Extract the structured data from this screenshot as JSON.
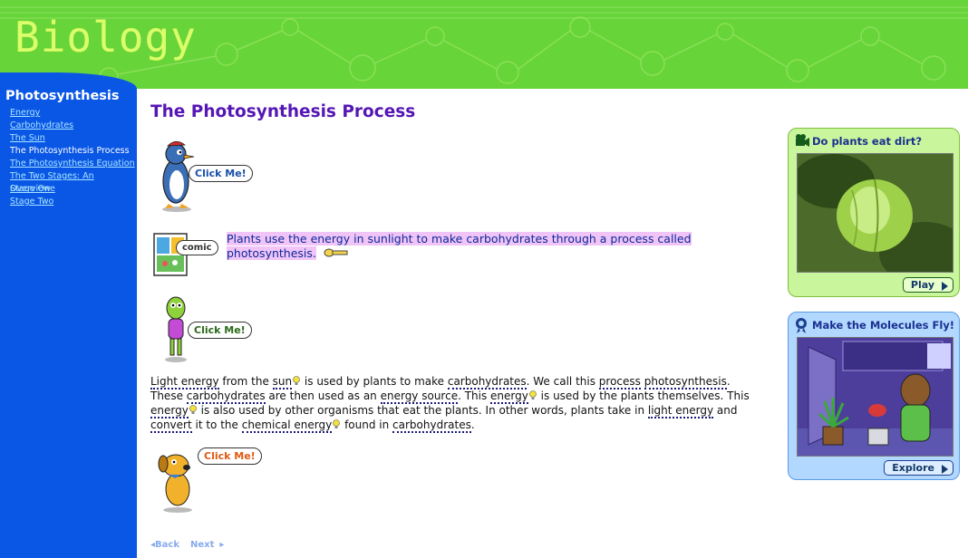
{
  "header": {
    "title": "Biology"
  },
  "sidebar": {
    "section_title": "Photosynthesis",
    "items": [
      {
        "label": "Energy",
        "current": false
      },
      {
        "label": "Carbohydrates",
        "current": false
      },
      {
        "label": "The Sun",
        "current": false
      },
      {
        "label": "The Photosynthesis Process",
        "current": true
      },
      {
        "label": "The Photosynthesis Equation",
        "current": false
      },
      {
        "label": "The Two Stages: An Overview",
        "current": false
      },
      {
        "label": "Stage One",
        "current": false
      },
      {
        "label": "Stage Two",
        "current": false
      }
    ]
  },
  "main": {
    "title": "The Photosynthesis Process",
    "characters": {
      "penguin_bubble": "Click Me!",
      "comic_bubble": "comic",
      "alien_bubble": "Click Me!",
      "dog_bubble": "Click Me!"
    },
    "intro_text": "Plants use the energy in sunlight to make carbohydrates through a process called photosynthesis.",
    "body": {
      "t1": "Light energy",
      "t2": " from the ",
      "t3": "sun",
      "t4": " is used by plants to make ",
      "t5": "carbohydrates",
      "t6": ". We call this ",
      "t7": "process",
      "t8": " ",
      "t9": "photosynthesis",
      "t10": ". These ",
      "t11": "carbohydrates",
      "t12": " are then used as an ",
      "t13": "energy source",
      "t14": ". This ",
      "t15": "energy",
      "t16": " is used by the plants themselves. This ",
      "t17": "energy",
      "t18": " is also used by other organisms that eat the plants. In other words, plants take in ",
      "t19": "light energy",
      "t20": " and ",
      "t21": "convert",
      "t22": " it to the ",
      "t23": "chemical energy",
      "t24": " found in ",
      "t25": "carbohydrates",
      "t26": "."
    },
    "nav": {
      "back": "Back",
      "next": "Next"
    }
  },
  "panels": {
    "video": {
      "title": "Do plants eat dirt?",
      "button": "Play"
    },
    "molecules": {
      "title": "Make the Molecules Fly!",
      "button": "Explore"
    }
  },
  "colors": {
    "header_green": "#67d43a",
    "title_green": "#d9ff6a",
    "sidebar_blue": "#0a57e6",
    "page_title_purple": "#5516b5",
    "highlight_pink": "#f1c4f7"
  }
}
